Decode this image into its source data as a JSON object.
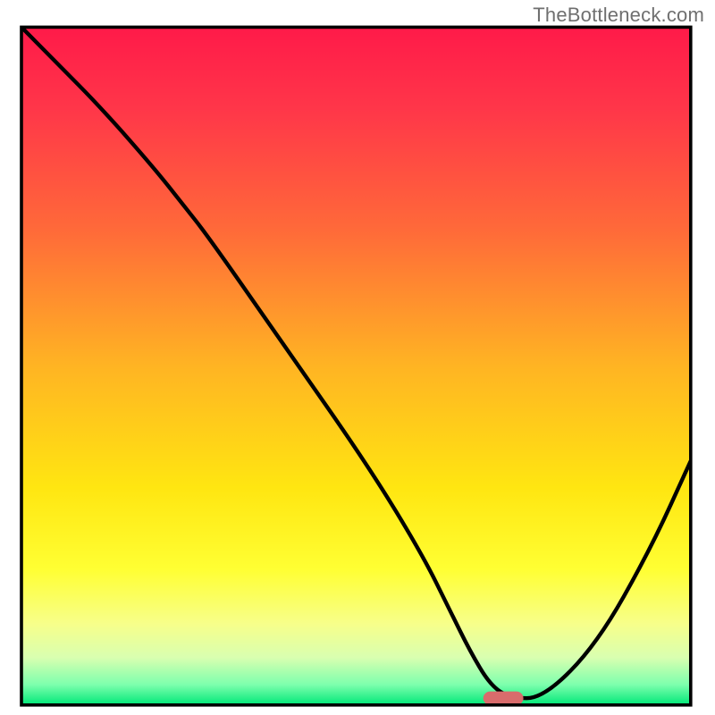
{
  "watermark": "TheBottleneck.com",
  "chart_data": {
    "type": "line",
    "title": "",
    "xlabel": "",
    "ylabel": "",
    "xlim": [
      0,
      100
    ],
    "ylim": [
      0,
      100
    ],
    "grid": false,
    "legend": false,
    "gradient_stops": [
      {
        "offset": 0.0,
        "color": "#ff1a49"
      },
      {
        "offset": 0.12,
        "color": "#ff3649"
      },
      {
        "offset": 0.3,
        "color": "#ff6a39"
      },
      {
        "offset": 0.5,
        "color": "#ffb423"
      },
      {
        "offset": 0.68,
        "color": "#ffe611"
      },
      {
        "offset": 0.8,
        "color": "#ffff33"
      },
      {
        "offset": 0.88,
        "color": "#f7ff8a"
      },
      {
        "offset": 0.93,
        "color": "#d9ffb0"
      },
      {
        "offset": 0.97,
        "color": "#7dffad"
      },
      {
        "offset": 1.0,
        "color": "#00e878"
      }
    ],
    "series": [
      {
        "name": "bottleneck-curve",
        "x": [
          0,
          5,
          12,
          20,
          24,
          28,
          40,
          52,
          60,
          64,
          67,
          70,
          73,
          78,
          86,
          94,
          100
        ],
        "y": [
          100,
          95,
          88,
          79,
          74,
          69,
          52,
          35,
          22,
          14,
          8,
          3,
          1,
          1,
          9,
          23,
          36
        ]
      }
    ],
    "marker": {
      "name": "optimal-point",
      "x": 72,
      "y": 1,
      "width": 6,
      "height": 2,
      "color": "#d96c6c"
    },
    "frame": {
      "x": 3.0,
      "y": 3.8,
      "width": 93.6,
      "height": 94.8,
      "stroke": "#000000",
      "stroke_width": 0.45
    }
  }
}
